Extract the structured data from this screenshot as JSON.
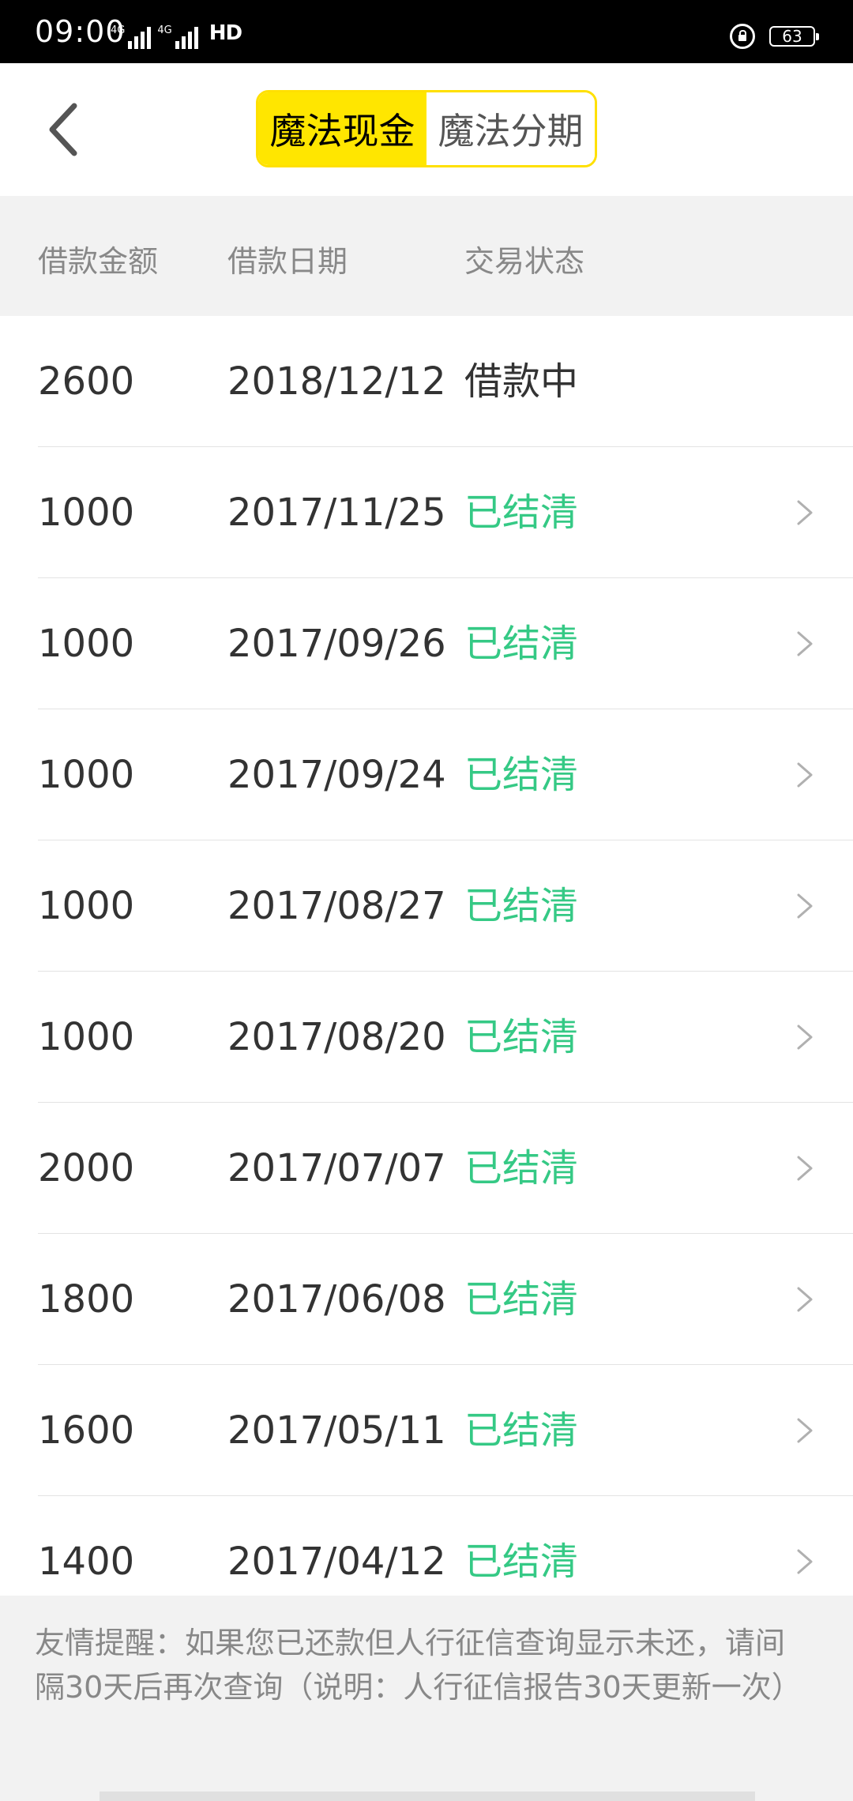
{
  "status_bar": {
    "time": "09:00",
    "signal_1_tag": "4G",
    "signal_2_tag": "4G",
    "hd_label": "HD",
    "battery": "63"
  },
  "header": {
    "tabs": [
      {
        "label": "魔法现金",
        "active": true
      },
      {
        "label": "魔法分期",
        "active": false
      }
    ]
  },
  "table": {
    "headers": {
      "amount": "借款金额",
      "date": "借款日期",
      "status": "交易状态"
    },
    "rows": [
      {
        "amount": "2600",
        "date": "2018/12/12",
        "status": "借款中",
        "state": "ongoing"
      },
      {
        "amount": "1000",
        "date": "2017/11/25",
        "status": "已结清",
        "state": "settled"
      },
      {
        "amount": "1000",
        "date": "2017/09/26",
        "status": "已结清",
        "state": "settled"
      },
      {
        "amount": "1000",
        "date": "2017/09/24",
        "status": "已结清",
        "state": "settled"
      },
      {
        "amount": "1000",
        "date": "2017/08/27",
        "status": "已结清",
        "state": "settled"
      },
      {
        "amount": "1000",
        "date": "2017/08/20",
        "status": "已结清",
        "state": "settled"
      },
      {
        "amount": "2000",
        "date": "2017/07/07",
        "status": "已结清",
        "state": "settled"
      },
      {
        "amount": "1800",
        "date": "2017/06/08",
        "status": "已结清",
        "state": "settled"
      },
      {
        "amount": "1600",
        "date": "2017/05/11",
        "status": "已结清",
        "state": "settled"
      },
      {
        "amount": "1400",
        "date": "2017/04/12",
        "status": "已结清",
        "state": "settled"
      }
    ]
  },
  "notice": {
    "text": "友情提醒：如果您已还款但人行征信查询显示未还，请间隔30天后再次查询（说明：人行征信报告30天更新一次）"
  },
  "colors": {
    "accent_yellow": "#ffe600",
    "settled_green": "#35c985",
    "header_bg": "#f2f2f2"
  },
  "icons": {
    "back": "chevron-left-icon",
    "row_arrow": "chevron-right-icon",
    "lock": "rotation-lock-icon",
    "battery": "battery-icon"
  }
}
